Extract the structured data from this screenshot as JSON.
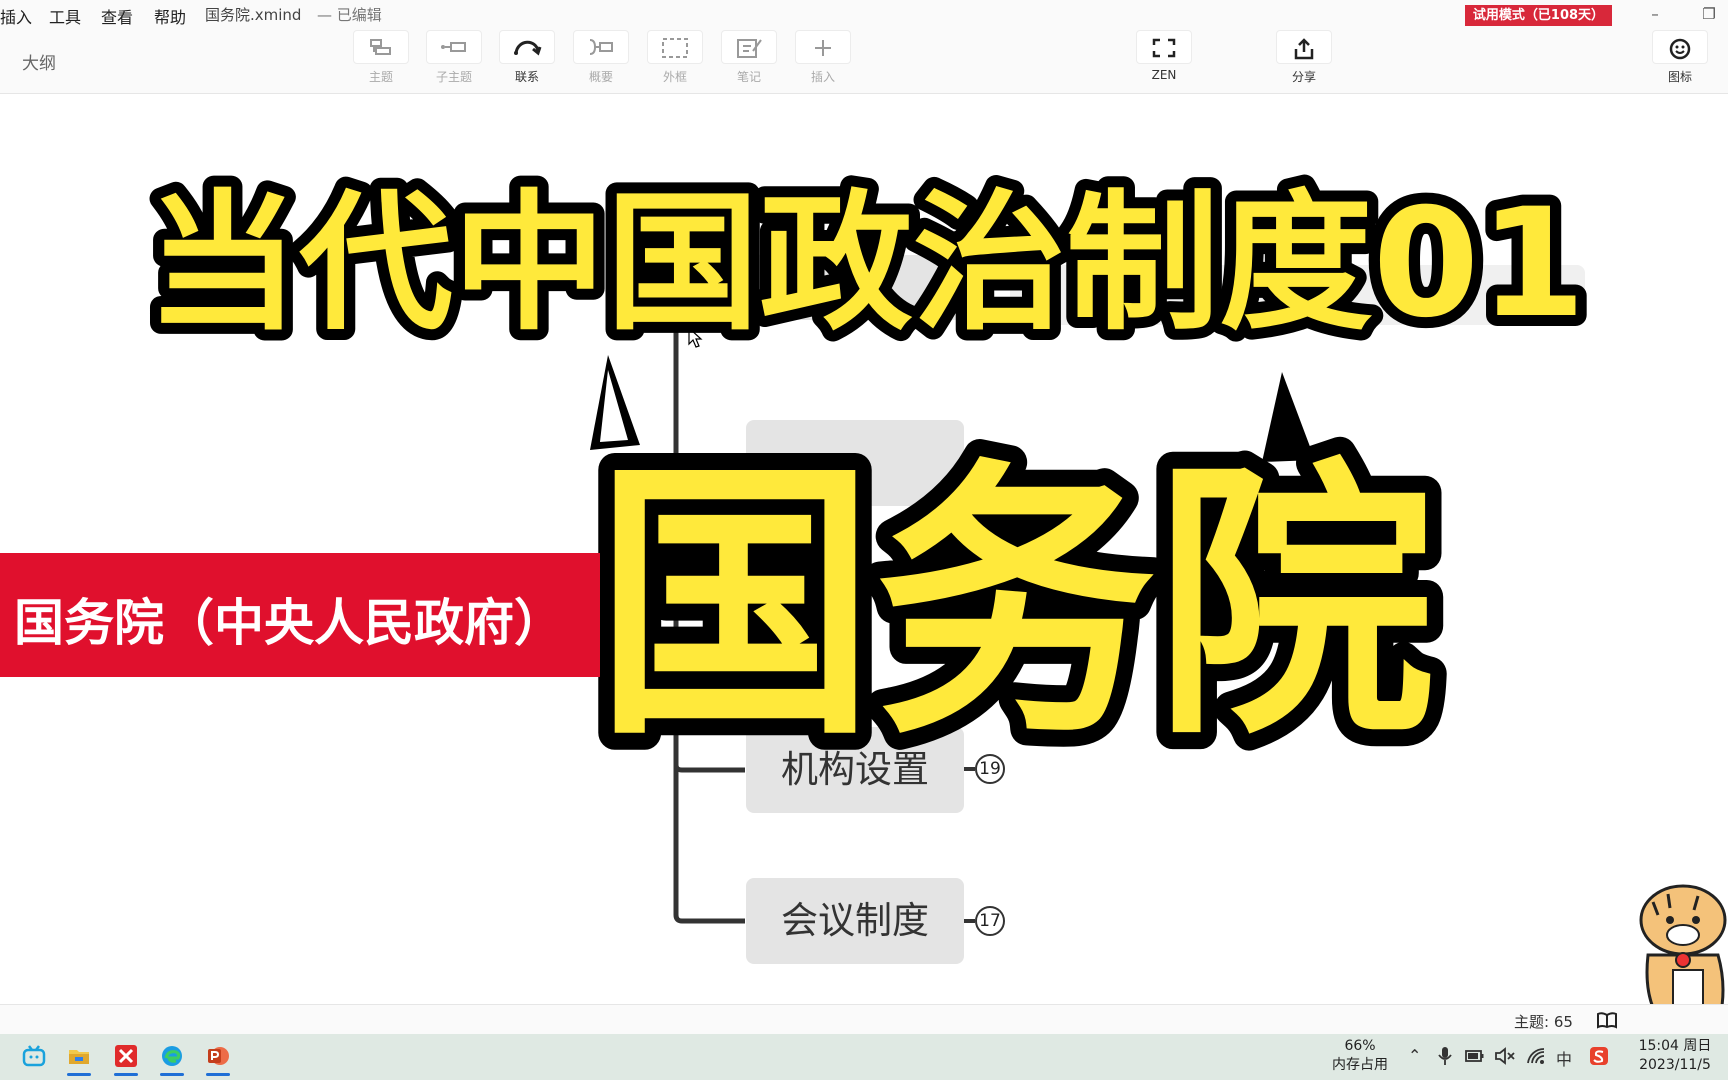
{
  "menubar": {
    "items": [
      "插入",
      "工具",
      "查看",
      "帮助"
    ],
    "document_title": "国务院.xmind",
    "document_status": "— 已编辑",
    "trial_badge": "试用模式（已108天）"
  },
  "toolbar": {
    "outline_label": "大纲",
    "tools": [
      {
        "label": "主题",
        "icon": "topic-icon"
      },
      {
        "label": "子主题",
        "icon": "subtopic-icon"
      },
      {
        "label": "联系",
        "icon": "relationship-icon"
      },
      {
        "label": "概要",
        "icon": "summary-icon"
      },
      {
        "label": "外框",
        "icon": "boundary-icon"
      },
      {
        "label": "笔记",
        "icon": "note-icon"
      },
      {
        "label": "插入",
        "icon": "plus-icon"
      }
    ],
    "zen_label": "ZEN",
    "share_label": "分享",
    "icon_label": "图标"
  },
  "canvas": {
    "nodes": [
      {
        "label": "机构设置",
        "count": "19"
      },
      {
        "label": "会议制度",
        "count": "17"
      }
    ]
  },
  "overlay": {
    "main_title": "当代中国政治制度01",
    "big_title": "国务院",
    "red_banner": "国务院（中央人民政府）"
  },
  "statusbar": {
    "topic_count": "主题: 65"
  },
  "taskbar": {
    "memory_percent": "66%",
    "memory_label": "内存占用",
    "tray_input_method": "中",
    "time": "15:04 周日",
    "date": "2023/11/5"
  },
  "colors": {
    "title_fill": "#ffe93b",
    "title_stroke": "#000000",
    "banner_red": "#e0102d",
    "trial_red": "#d8283a"
  }
}
